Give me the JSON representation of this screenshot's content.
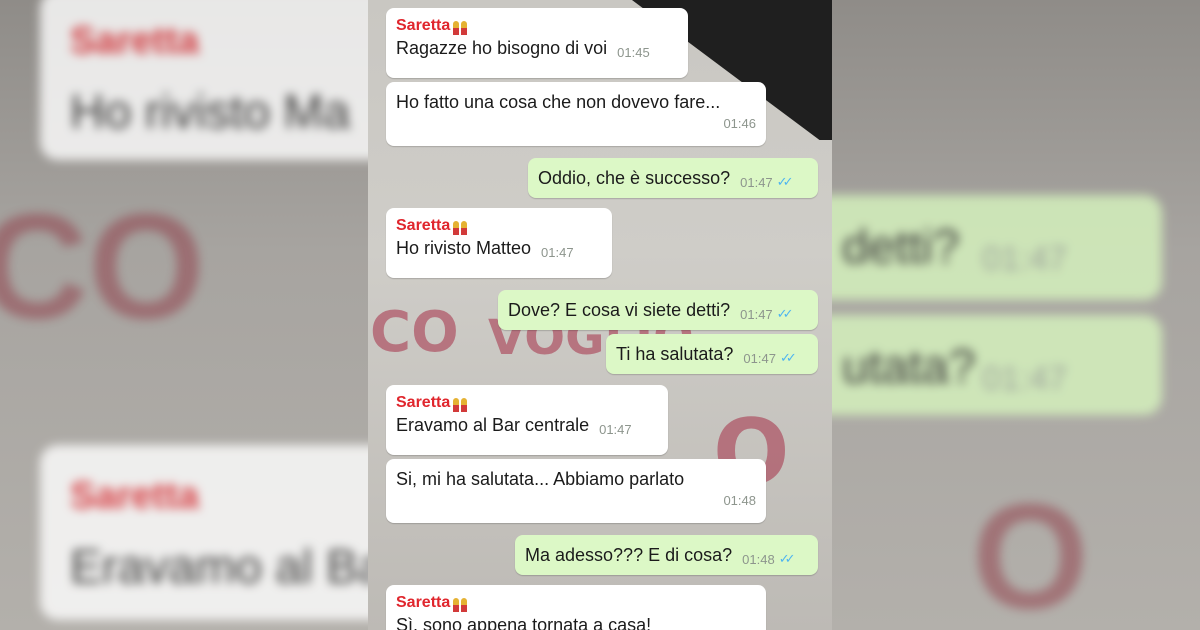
{
  "chat": {
    "messages": [
      {
        "direction": "in",
        "sender": "Saretta",
        "text": "Ragazze ho bisogno di voi",
        "time": "01:45"
      },
      {
        "direction": "in",
        "sender": "",
        "text": "Ho fatto una cosa che non dovevo fare...",
        "time": "01:46"
      },
      {
        "direction": "out",
        "text": "Oddio, che è successo?",
        "time": "01:47",
        "status": "read"
      },
      {
        "direction": "in",
        "sender": "Saretta",
        "text": "Ho rivisto Matteo",
        "time": "01:47"
      },
      {
        "direction": "out",
        "text": "Dove? E cosa vi siete detti?",
        "time": "01:47",
        "status": "read"
      },
      {
        "direction": "out",
        "text": "Ti ha salutata?",
        "time": "01:47",
        "status": "read"
      },
      {
        "direction": "in",
        "sender": "Saretta",
        "text": "Eravamo al Bar centrale",
        "time": "01:47"
      },
      {
        "direction": "in",
        "sender": "",
        "text": "Si, mi ha salutata... Abbiamo parlato",
        "time": "01:48"
      },
      {
        "direction": "out",
        "text": "Ma adesso??? E di cosa?",
        "time": "01:48",
        "status": "read"
      },
      {
        "direction": "in",
        "sender": "Saretta",
        "text": "Sì, sono appena tornata a casa!",
        "time": ""
      }
    ]
  },
  "background_left": {
    "sender_1": "Saretta",
    "text_1": "Ho rivisto Ma",
    "sender_2": "Saretta",
    "text_2": "Eravamo al Ba",
    "graffiti": "CO"
  },
  "background_right": {
    "text_1": "detti?",
    "time_1": "01:47",
    "text_2": "utata?",
    "time_2": "01:47",
    "graffiti": "O"
  },
  "graffiti_text": {
    "g1": "CO",
    "g2": "VOGLIO",
    "g3": "O"
  },
  "colors": {
    "incoming_bubble": "#ffffff",
    "outgoing_bubble": "#dcf8c6",
    "sender_name": "#e0262d",
    "read_ticks": "#4fb5f0"
  },
  "icons": {
    "sender_emoji": "couple-emoji-icon",
    "read_status": "double-check-icon"
  }
}
